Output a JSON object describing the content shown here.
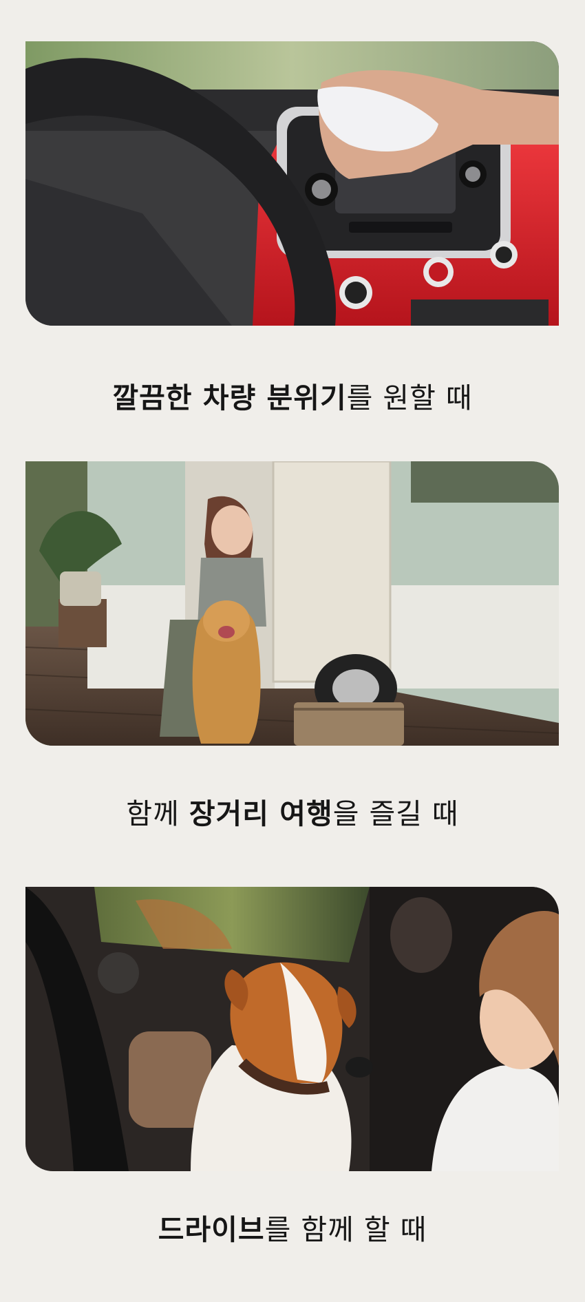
{
  "sections": [
    {
      "caption": {
        "pre": "",
        "bold": "깔끔한 차량 분위기",
        "post": "를 원할 때"
      },
      "colors": {
        "dashboard": "#d8202a",
        "panel": "#2a2a2c"
      }
    },
    {
      "caption": {
        "pre": "함께 ",
        "bold": "장거리 여행",
        "post": "을 즐길 때"
      },
      "colors": {
        "trailer": "#b9c8bb",
        "deck": "#5a4436"
      }
    },
    {
      "caption": {
        "pre": "",
        "bold": "드라이브",
        "post": "를 함께 할 때"
      },
      "colors": {
        "interior": "#2b2624",
        "dog": "#c06a2a"
      }
    }
  ]
}
